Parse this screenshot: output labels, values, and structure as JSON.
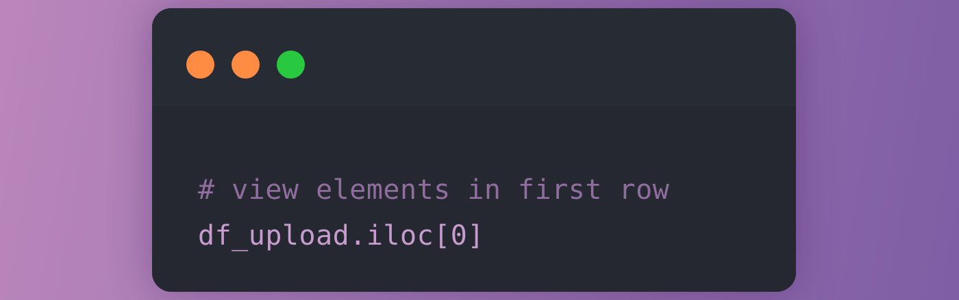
{
  "window": {
    "controls": [
      {
        "name": "close",
        "color": "#ff8c42"
      },
      {
        "name": "minimize",
        "color": "#ff8c42"
      },
      {
        "name": "maximize",
        "color": "#28c940"
      }
    ]
  },
  "code": {
    "comment": "# view elements in first row",
    "statement": "df_upload.iloc[0]"
  },
  "colors": {
    "background_start": "#bb86bb",
    "background_end": "#7f5ea5",
    "window_bg": "#262a33",
    "comment_text": "#8f6d9f",
    "code_text": "#c79dcf"
  }
}
